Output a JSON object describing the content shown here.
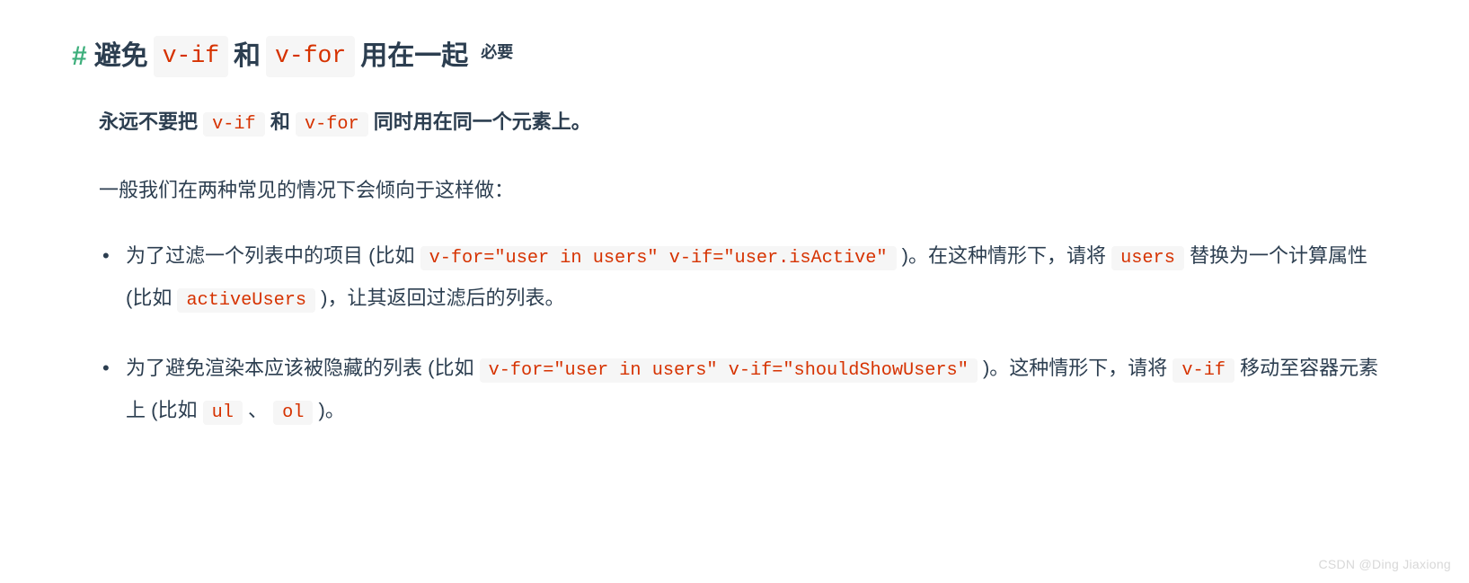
{
  "heading": {
    "hash": "#",
    "part1": "避免",
    "code1": "v-if",
    "part2": "和",
    "code2": "v-for",
    "part3": "用在一起",
    "badge": "必要"
  },
  "bold_para": {
    "p1": "永远不要把 ",
    "c1": "v-if",
    "p2": " 和 ",
    "c2": "v-for",
    "p3": " 同时用在同一个元素上。"
  },
  "normal_para": "一般我们在两种常见的情况下会倾向于这样做：",
  "bullets": [
    {
      "t1": "为了过滤一个列表中的项目 (比如 ",
      "c1": "v-for=\"user in users\" v-if=\"user.isActive\"",
      "t2": " )。在这种情形下，请将 ",
      "c2": "users",
      "t3": " 替换为一个计算属性 (比如 ",
      "c3": "activeUsers",
      "t4": " )，让其返回过滤后的列表。"
    },
    {
      "t1": "为了避免渲染本应该被隐藏的列表 (比如 ",
      "c1": "v-for=\"user in users\" v-if=\"shouldShowUsers\"",
      "t2": " )。这种情形下，请将 ",
      "c2": "v-if",
      "t3": " 移动至容器元素上 (比如 ",
      "c3": "ul",
      "t4": " 、 ",
      "c4": "ol",
      "t5": " )。"
    }
  ],
  "watermark": "CSDN @Ding Jiaxiong"
}
